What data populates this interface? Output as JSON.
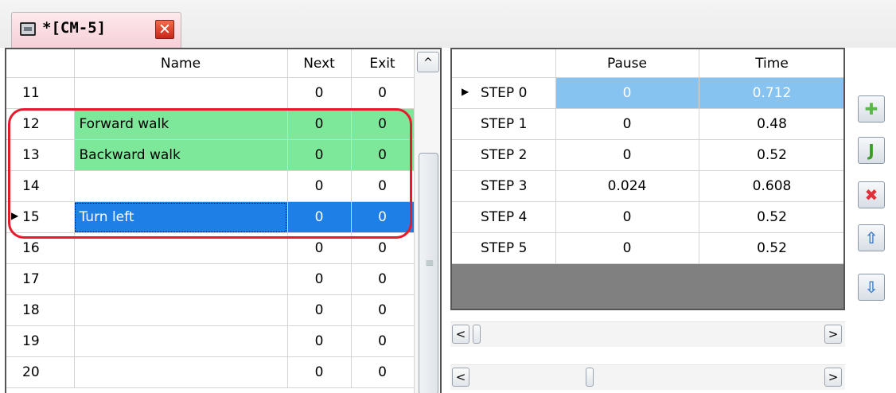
{
  "tab": {
    "title": "*[CM-5]",
    "close_label": "✕"
  },
  "motion_grid": {
    "columns": [
      "Name",
      "Next",
      "Exit"
    ],
    "rows": [
      {
        "num": "11",
        "name": "",
        "next": "0",
        "exit": "0",
        "state": "normal"
      },
      {
        "num": "12",
        "name": "Forward walk",
        "next": "0",
        "exit": "0",
        "state": "green"
      },
      {
        "num": "13",
        "name": "Backward walk",
        "next": "0",
        "exit": "0",
        "state": "green"
      },
      {
        "num": "14",
        "name": "",
        "next": "0",
        "exit": "0",
        "state": "normal"
      },
      {
        "num": "15",
        "name": "Turn left",
        "next": "0",
        "exit": "0",
        "state": "selected"
      },
      {
        "num": "16",
        "name": "",
        "next": "0",
        "exit": "0",
        "state": "normal"
      },
      {
        "num": "17",
        "name": "",
        "next": "0",
        "exit": "0",
        "state": "normal"
      },
      {
        "num": "18",
        "name": "",
        "next": "0",
        "exit": "0",
        "state": "normal"
      },
      {
        "num": "19",
        "name": "",
        "next": "0",
        "exit": "0",
        "state": "normal"
      },
      {
        "num": "20",
        "name": "",
        "next": "0",
        "exit": "0",
        "state": "normal"
      }
    ]
  },
  "step_grid": {
    "columns": [
      "Pause",
      "Time"
    ],
    "rows": [
      {
        "step": "STEP 0",
        "pause": "0",
        "time": "0.712",
        "current": true
      },
      {
        "step": "STEP 1",
        "pause": "0",
        "time": "0.48",
        "current": false
      },
      {
        "step": "STEP 2",
        "pause": "0",
        "time": "0.52",
        "current": false
      },
      {
        "step": "STEP 3",
        "pause": "0.024",
        "time": "0.608",
        "current": false
      },
      {
        "step": "STEP 4",
        "pause": "0",
        "time": "0.52",
        "current": false
      },
      {
        "step": "STEP 5",
        "pause": "0",
        "time": "0.52",
        "current": false
      }
    ]
  },
  "side_buttons": [
    {
      "name": "add-step-icon",
      "glyph": "✚",
      "color": "#5ab84a"
    },
    {
      "name": "insert-step-icon",
      "glyph": "J",
      "color": "#3a9a2a"
    },
    {
      "name": "delete-step-icon",
      "glyph": "✖",
      "color": "#e0303a"
    },
    {
      "name": "move-up-icon",
      "glyph": "⇧",
      "color": "#3f7fd0"
    },
    {
      "name": "move-down-icon",
      "glyph": "⇩",
      "color": "#3f7fd0"
    }
  ],
  "scroll_glyphs": {
    "up": "^",
    "left": "<",
    "right": ">"
  },
  "colors": {
    "green_row": "#7ee89a",
    "selected_row": "#1e7fe6",
    "current_step": "#86c3f1",
    "highlight": "#e8192c"
  }
}
